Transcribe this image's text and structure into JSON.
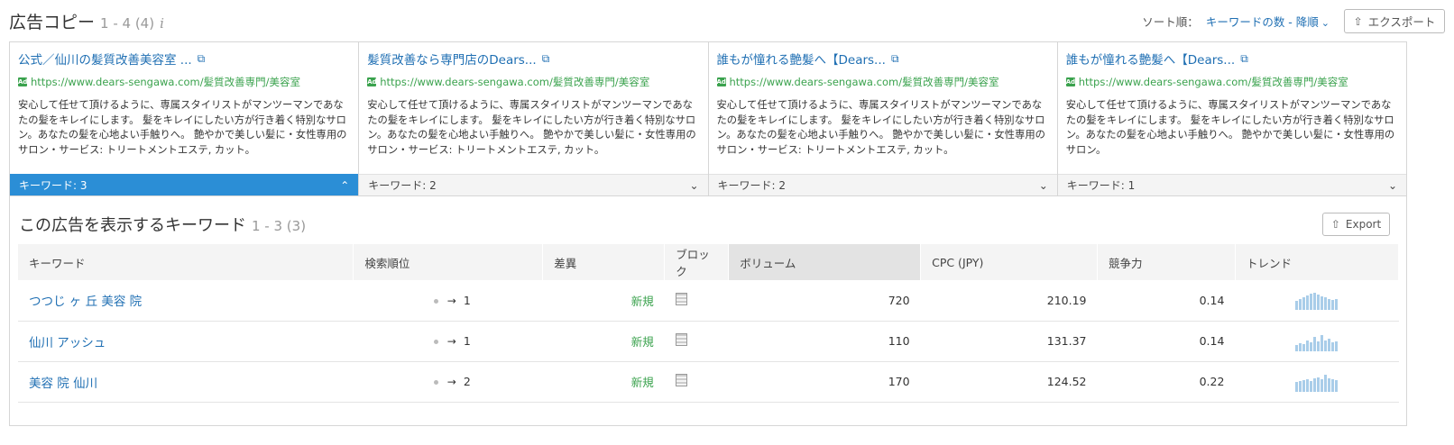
{
  "header": {
    "title": "広告コピー",
    "range": "1 - 4 (4)",
    "info": "i",
    "sort_label": "ソート順：",
    "sort_value": "キーワードの数 - 降順",
    "export_label": "エクスポート"
  },
  "cards": [
    {
      "title": "公式／仙川の髪質改善美容室 ...",
      "url": "https://www.dears-sengawa.com/髪質改善専門/美容室",
      "desc": "安心して任せて頂けるように、専属スタイリストがマンツーマンであなたの髪をキレイにします。 髪をキレイにしたい方が行き着く特別なサロン。あなたの髪を心地よい手触りへ。 艶やかで美しい髪に・女性専用のサロン・サービス: トリートメントエステ, カット。",
      "footer": "キーワード: 3",
      "active": true
    },
    {
      "title": "髪質改善なら専門店のDears...",
      "url": "https://www.dears-sengawa.com/髪質改善専門/美容室",
      "desc": "安心して任せて頂けるように、専属スタイリストがマンツーマンであなたの髪をキレイにします。 髪をキレイにしたい方が行き着く特別なサロン。あなたの髪を心地よい手触りへ。 艶やかで美しい髪に・女性専用のサロン・サービス: トリートメントエステ, カット。",
      "footer": "キーワード: 2",
      "active": false
    },
    {
      "title": "誰もが憧れる艶髪へ【Dears...",
      "url": "https://www.dears-sengawa.com/髪質改善専門/美容室",
      "desc": "安心して任せて頂けるように、専属スタイリストがマンツーマンであなたの髪をキレイにします。 髪をキレイにしたい方が行き着く特別なサロン。あなたの髪を心地よい手触りへ。 艶やかで美しい髪に・女性専用のサロン・サービス: トリートメントエステ, カット。",
      "footer": "キーワード: 2",
      "active": false
    },
    {
      "title": "誰もが憧れる艶髪へ【Dears...",
      "url": "https://www.dears-sengawa.com/髪質改善専門/美容室",
      "desc": "安心して任せて頂けるように、専属スタイリストがマンツーマンであなたの髪をキレイにします。 髪をキレイにしたい方が行き着く特別なサロン。あなたの髪を心地よい手触りへ。 艶やかで美しい髪に・女性専用のサロン。",
      "footer": "キーワード: 1",
      "active": false
    }
  ],
  "keywords": {
    "title": "この広告を表示するキーワード",
    "range": "1 - 3 (3)",
    "export_label": "Export",
    "columns": [
      "キーワード",
      "検索順位",
      "差異",
      "ブロック",
      "ボリューム",
      "CPC (JPY)",
      "競争力",
      "トレンド"
    ],
    "rows": [
      {
        "keyword": "つつじ ヶ 丘 美容 院",
        "arrow": "→",
        "rank": "1",
        "diff": "新規",
        "volume": "720",
        "cpc": "210.19",
        "competition": "0.14",
        "trend": [
          0.5,
          0.6,
          0.7,
          0.8,
          0.9,
          0.95,
          0.85,
          0.75,
          0.7,
          0.6,
          0.55,
          0.6
        ]
      },
      {
        "keyword": "仙川 アッシュ",
        "arrow": "→",
        "rank": "1",
        "diff": "新規",
        "volume": "110",
        "cpc": "131.37",
        "competition": "0.14",
        "trend": [
          0.35,
          0.45,
          0.4,
          0.6,
          0.5,
          0.8,
          0.55,
          0.9,
          0.6,
          0.7,
          0.5,
          0.55
        ]
      },
      {
        "keyword": "美容 院 仙川",
        "arrow": "→",
        "rank": "2",
        "diff": "新規",
        "volume": "170",
        "cpc": "124.52",
        "competition": "0.22",
        "trend": [
          0.55,
          0.6,
          0.65,
          0.7,
          0.6,
          0.75,
          0.8,
          0.7,
          0.95,
          0.75,
          0.7,
          0.65
        ]
      }
    ]
  }
}
